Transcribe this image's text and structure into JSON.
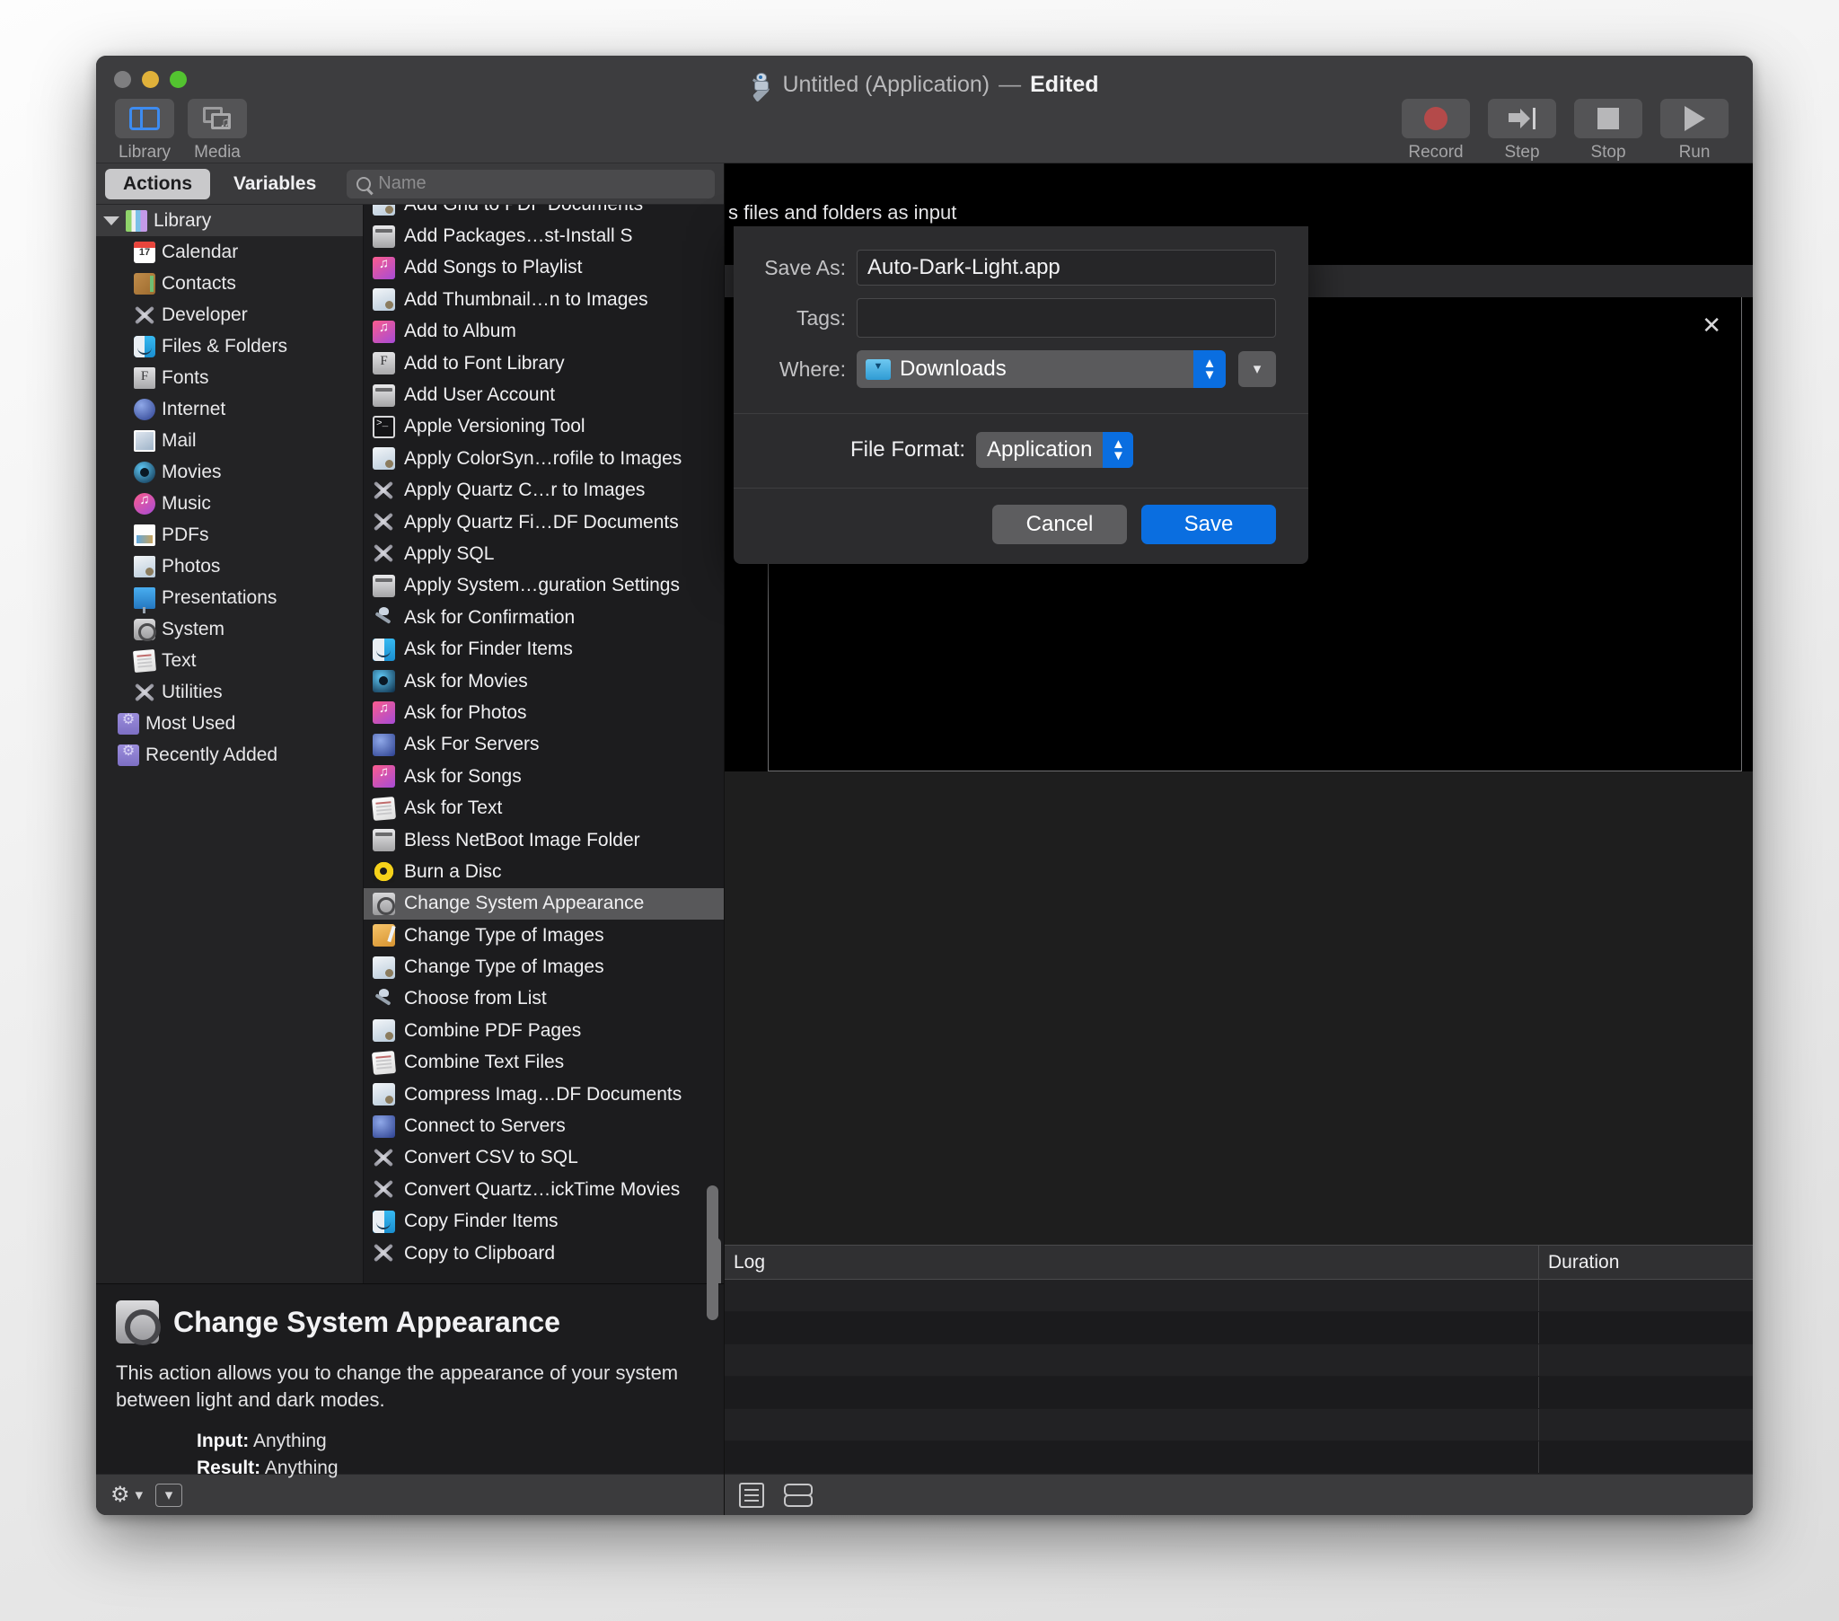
{
  "window": {
    "title_doc": "Untitled (Application)",
    "title_dash": "—",
    "title_edited": "Edited",
    "title_icon": "automator-robot-icon"
  },
  "toolbar": {
    "left": [
      {
        "label": "Library",
        "icon": "library-panel-icon",
        "active": true
      },
      {
        "label": "Media",
        "icon": "media-browser-icon",
        "active": false
      }
    ],
    "right": [
      {
        "label": "Record",
        "icon": "record-circle-icon"
      },
      {
        "label": "Step",
        "icon": "step-arrow-icon"
      },
      {
        "label": "Stop",
        "icon": "stop-square-icon"
      },
      {
        "label": "Run",
        "icon": "run-play-icon"
      }
    ]
  },
  "library_panel": {
    "tabs": [
      {
        "label": "Actions",
        "active": true
      },
      {
        "label": "Variables",
        "active": false
      }
    ],
    "search": {
      "placeholder": "Name",
      "value": ""
    },
    "tree": {
      "root": {
        "label": "Library",
        "icon": "books-icon",
        "expanded": true
      },
      "children": [
        {
          "label": "Calendar",
          "icon": "calendar-icon"
        },
        {
          "label": "Contacts",
          "icon": "contacts-icon"
        },
        {
          "label": "Developer",
          "icon": "crossed-tools-icon"
        },
        {
          "label": "Files & Folders",
          "icon": "finder-icon"
        },
        {
          "label": "Fonts",
          "icon": "font-book-icon"
        },
        {
          "label": "Internet",
          "icon": "globe-icon"
        },
        {
          "label": "Mail",
          "icon": "mail-icon"
        },
        {
          "label": "Movies",
          "icon": "quicktime-icon"
        },
        {
          "label": "Music",
          "icon": "music-icon"
        },
        {
          "label": "PDFs",
          "icon": "pdf-document-icon"
        },
        {
          "label": "Photos",
          "icon": "photos-icon"
        },
        {
          "label": "Presentations",
          "icon": "presentation-icon"
        },
        {
          "label": "System",
          "icon": "system-gear-icon"
        },
        {
          "label": "Text",
          "icon": "text-document-icon"
        },
        {
          "label": "Utilities",
          "icon": "crossed-tools-icon"
        }
      ],
      "smart_folders": [
        {
          "label": "Most Used",
          "icon": "smart-folder-icon"
        },
        {
          "label": "Recently Added",
          "icon": "smart-folder-icon"
        }
      ]
    },
    "actions": [
      {
        "label": "Add Grid to PDF Documents",
        "icon": "image-preview-icon",
        "selected": false
      },
      {
        "label": "Add Packages…st-Install S",
        "icon": "installer-icon",
        "selected": false
      },
      {
        "label": "Add Songs to Playlist",
        "icon": "music-icon",
        "selected": false
      },
      {
        "label": "Add Thumbnail…n to Images",
        "icon": "image-preview-icon",
        "selected": false
      },
      {
        "label": "Add to Album",
        "icon": "photos-app-icon",
        "selected": false
      },
      {
        "label": "Add to Font Library",
        "icon": "font-book-icon",
        "selected": false
      },
      {
        "label": "Add User Account",
        "icon": "installer-icon",
        "selected": false
      },
      {
        "label": "Apple Versioning Tool",
        "icon": "terminal-icon",
        "selected": false
      },
      {
        "label": "Apply ColorSyn…rofile to Images",
        "icon": "image-preview-icon",
        "selected": false
      },
      {
        "label": "Apply Quartz C…r to Images",
        "icon": "crossed-tools-icon",
        "selected": false
      },
      {
        "label": "Apply Quartz Fi…DF Documents",
        "icon": "crossed-tools-icon",
        "selected": false
      },
      {
        "label": "Apply SQL",
        "icon": "crossed-tools-icon",
        "selected": false
      },
      {
        "label": "Apply System…guration Settings",
        "icon": "installer-icon",
        "selected": false
      },
      {
        "label": "Ask for Confirmation",
        "icon": "automator-robot-icon",
        "selected": false
      },
      {
        "label": "Ask for Finder Items",
        "icon": "finder-icon",
        "selected": false
      },
      {
        "label": "Ask for Movies",
        "icon": "quicktime-icon",
        "selected": false
      },
      {
        "label": "Ask for Photos",
        "icon": "photos-app-icon",
        "selected": false
      },
      {
        "label": "Ask For Servers",
        "icon": "globe-icon",
        "selected": false
      },
      {
        "label": "Ask for Songs",
        "icon": "music-icon",
        "selected": false
      },
      {
        "label": "Ask for Text",
        "icon": "text-document-icon",
        "selected": false
      },
      {
        "label": "Bless NetBoot Image Folder",
        "icon": "installer-icon",
        "selected": false
      },
      {
        "label": "Burn a Disc",
        "icon": "burn-disc-icon",
        "selected": false
      },
      {
        "label": "Change System Appearance",
        "icon": "system-gear-icon",
        "selected": true
      },
      {
        "label": "Change Type of Images",
        "icon": "image-editor-icon",
        "selected": false
      },
      {
        "label": "Change Type of Images",
        "icon": "image-preview-icon",
        "selected": false
      },
      {
        "label": "Choose from List",
        "icon": "automator-robot-icon",
        "selected": false
      },
      {
        "label": "Combine PDF Pages",
        "icon": "image-preview-icon",
        "selected": false
      },
      {
        "label": "Combine Text Files",
        "icon": "text-document-icon",
        "selected": false
      },
      {
        "label": "Compress Imag…DF Documents",
        "icon": "image-preview-icon",
        "selected": false
      },
      {
        "label": "Connect to Servers",
        "icon": "globe-icon",
        "selected": false
      },
      {
        "label": "Convert CSV to SQL",
        "icon": "crossed-tools-icon",
        "selected": false
      },
      {
        "label": "Convert Quartz…ickTime Movies",
        "icon": "crossed-tools-icon",
        "selected": false
      },
      {
        "label": "Copy Finder Items",
        "icon": "finder-icon",
        "selected": false
      },
      {
        "label": "Copy to Clipboard",
        "icon": "crossed-tools-icon",
        "selected": false
      }
    ],
    "description": {
      "icon": "system-gear-icon",
      "title": "Change System Appearance",
      "text": "This action allows you to change the appearance of your system between light and dark modes.",
      "input_label": "Input:",
      "input_value": "Anything",
      "result_label": "Result:",
      "result_value": "Anything"
    },
    "footer": {
      "gear_icon": "gear-icon",
      "gear_chevron_icon": "chevron-down-icon",
      "disclosure_icon": "chevron-down-icon"
    }
  },
  "workflow": {
    "input_text": "s files and folders as input",
    "close_icon": "close-icon",
    "log": {
      "columns": [
        "Log",
        "Duration"
      ],
      "rows": []
    },
    "footer": {
      "list_view_icon": "list-view-icon",
      "split_view_icon": "split-view-icon"
    }
  },
  "save_dialog": {
    "fields": {
      "save_as_label": "Save As:",
      "save_as_value": "Auto-Dark-Light.app",
      "tags_label": "Tags:",
      "tags_value": "",
      "where_label": "Where:",
      "where_value": "Downloads",
      "where_icon": "downloads-folder-icon",
      "disclosure_icon": "chevron-down-icon",
      "file_format_label": "File Format:",
      "file_format_value": "Application"
    },
    "buttons": {
      "cancel": "Cancel",
      "save": "Save"
    },
    "accent_color": "#0a6ee0"
  }
}
